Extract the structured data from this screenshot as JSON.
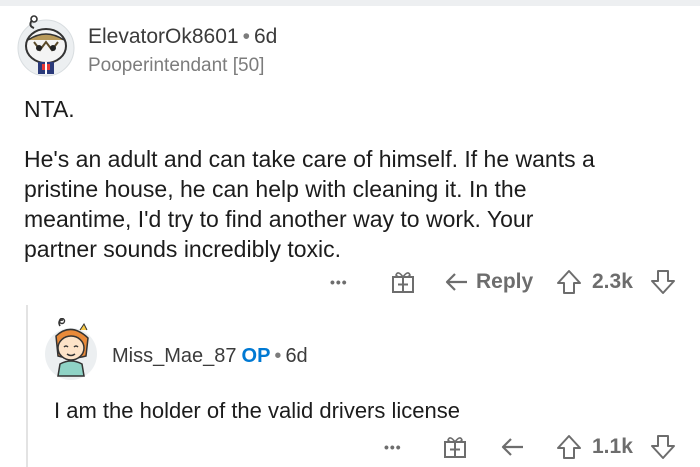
{
  "comment": {
    "username": "ElevatorOk8601",
    "time": "6d",
    "flair": "Pooperintendant [50]",
    "verdict": "NTA.",
    "body_lines": [
      "He's an adult and can take care of himself. If he wants a",
      "pristine house, he can help with cleaning it. In the",
      "meantime, I'd try to find another way to work. Your",
      "partner sounds incredibly toxic."
    ],
    "reply_label": "Reply",
    "score": "2.3k"
  },
  "reply": {
    "username": "Miss_Mae_87",
    "op_badge": "OP",
    "time": "6d",
    "body": "I am the holder of the valid drivers license",
    "score": "1.1k"
  },
  "separator": "•",
  "more_label": "•••",
  "icons": {
    "more": "more-icon",
    "award": "award-icon",
    "reply": "reply-arrow-icon",
    "upvote": "upvote-icon",
    "downvote": "downvote-icon"
  },
  "colors": {
    "op_blue": "#0079d3",
    "meta_gray": "#7c7c7c",
    "action_gray": "#6d6d6d"
  }
}
